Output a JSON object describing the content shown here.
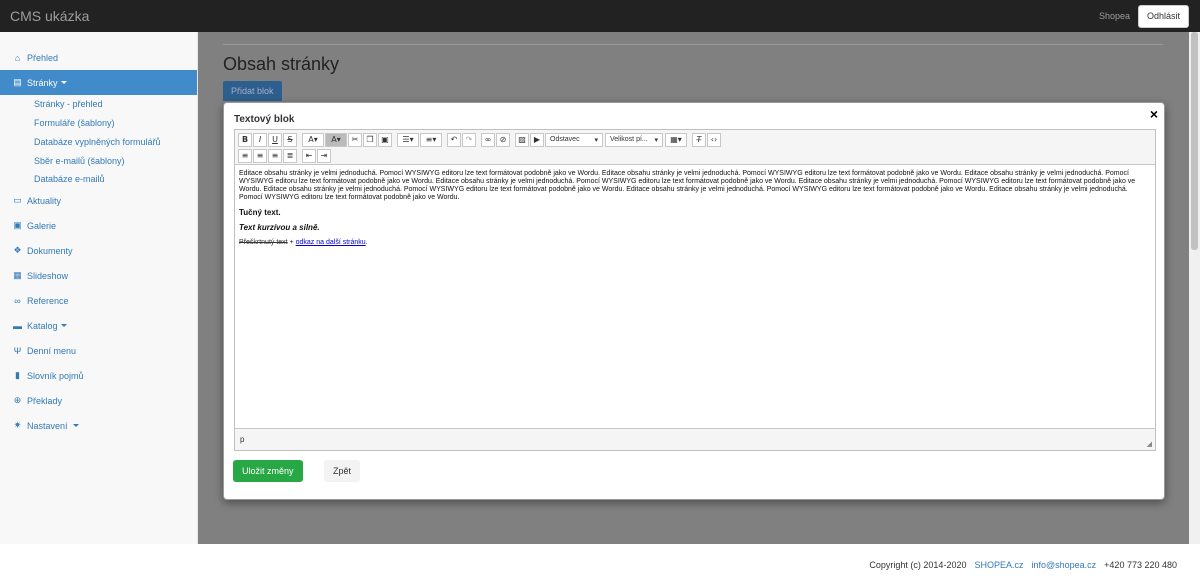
{
  "navbar": {
    "brand": "CMS ukázka",
    "user": "Shopea",
    "logout_label": "Odhlásit"
  },
  "sidebar": {
    "items": [
      {
        "label": "Přehled",
        "icon": "home-icon"
      },
      {
        "label": "Stránky",
        "icon": "file-icon"
      },
      {
        "label": "Aktuality",
        "icon": "laptop-icon"
      },
      {
        "label": "Galerie",
        "icon": "images-icon"
      },
      {
        "label": "Dokumenty",
        "icon": "cubes-icon"
      },
      {
        "label": "Slideshow",
        "icon": "slideshow-icon"
      },
      {
        "label": "Reference",
        "icon": "handshake-icon"
      },
      {
        "label": "Katalog",
        "icon": "briefcase-icon"
      },
      {
        "label": "Denní menu",
        "icon": "cutlery-icon"
      },
      {
        "label": "Slovník pojmů",
        "icon": "book-icon"
      },
      {
        "label": "Překlady",
        "icon": "globe-icon"
      },
      {
        "label": "Nastavení",
        "icon": "gear-icon"
      }
    ],
    "subitems": [
      "Stránky - přehled",
      "Formuláře (šablony)",
      "Databáze vyplněných formulářů",
      "Sběr e-mailů (šablony)",
      "Databáze e-mailů"
    ]
  },
  "page": {
    "title": "Obsah stránky",
    "add_block_label": "Přidat blok"
  },
  "modal": {
    "title": "Textový blok",
    "close_label": "×",
    "toolbar": {
      "format_combo": "Odstavec",
      "size_combo": "Velikost pí..."
    },
    "content": {
      "paragraph": "Editace obsahu stránky je velmi jednoduchá. Pomocí WYSIWYG editoru lze text formátovat podobně jako ve Wordu. Editace obsahu stránky je velmi jednoduchá. Pomocí WYSIWYG editoru lze text formátovat podobně jako ve Wordu. Editace obsahu stránky je velmi jednoduchá. Pomocí WYSIWYG editoru lze text formátovat podobně jako ve Wordu. Editace obsahu stránky je velmi jednoduchá. Pomocí WYSIWYG editoru lze text formátovat podobně jako ve Wordu. Editace obsahu stránky je velmi jednoduchá. Pomocí WYSIWYG editoru lze text formátovat podobně jako ve Wordu. Editace obsahu stránky je velmi jednoduchá. Pomocí WYSIWYG editoru lze text formátovat podobně jako ve Wordu. Editace obsahu stránky je velmi jednoduchá. Pomocí WYSIWYG editoru lze text formátovat podobně jako ve Wordu. Editace obsahu stránky je velmi jednoduchá. Pomocí WYSIWYG editoru lze text formátovat podobně jako ve Wordu.",
      "bold": "Tučný text.",
      "bold_italic": "Text kurzívou a silně.",
      "strike": "Přeškrtnutý text",
      "plus": " + ",
      "link": "odkaz na další stránku",
      "period": "."
    },
    "status_path": "p",
    "save_label": "Uložit změny",
    "back_label": "Zpět"
  },
  "footer": {
    "copyright": "Copyright (c) 2014-2020",
    "site": "SHOPEA.cz",
    "email": "info@shopea.cz",
    "phone": "+420 773 220 480"
  },
  "colors": {
    "accent": "#428bca",
    "link": "#337ab7",
    "save": "#28a745",
    "navbar": "#222222"
  }
}
